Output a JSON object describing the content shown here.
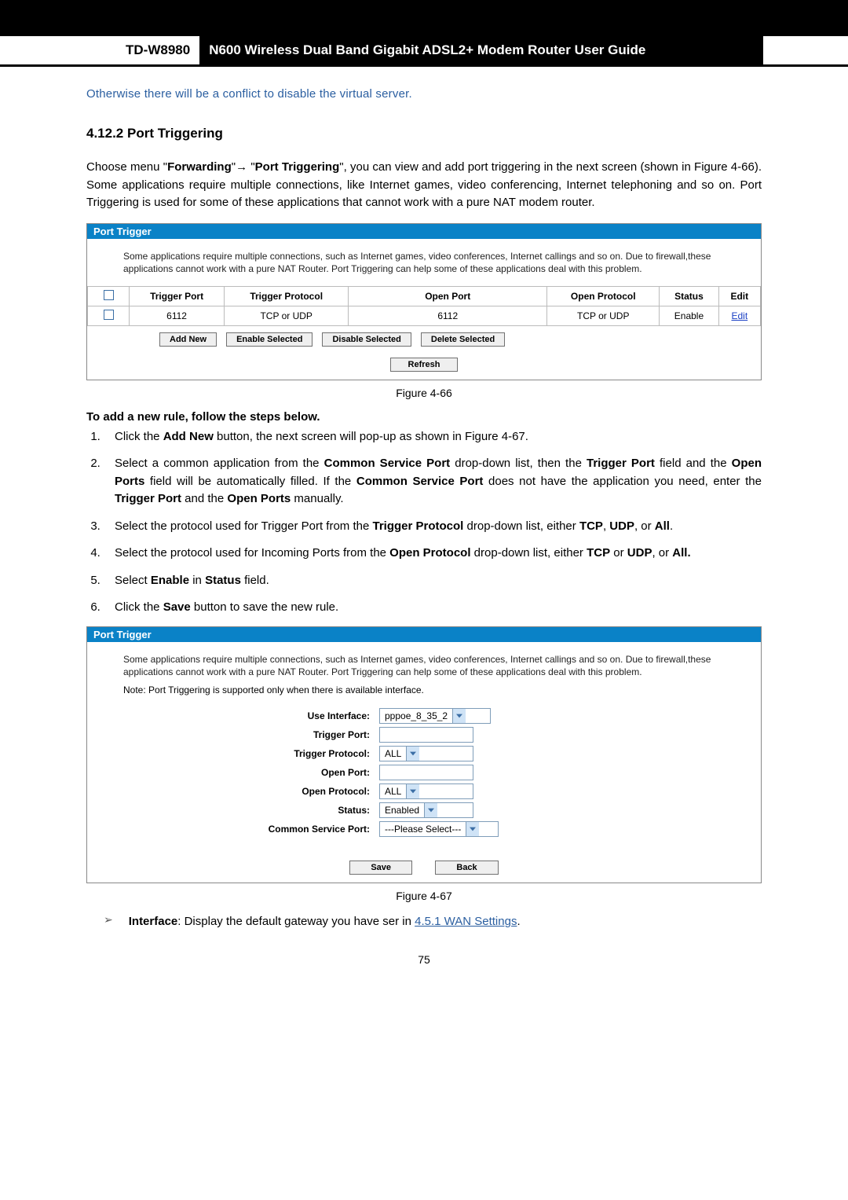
{
  "header": {
    "model": "TD-W8980",
    "guide_title": "N600 Wireless Dual Band Gigabit ADSL2+ Modem Router User Guide"
  },
  "note": "Otherwise there will be a conflict to disable the virtual server.",
  "section": {
    "number": "4.12.2",
    "title": "Port Triggering"
  },
  "intro": {
    "pre": "Choose menu \"",
    "menu1": "Forwarding",
    "arrow": "→",
    "quote_open": "\"",
    "menu2": "Port Triggering",
    "post": "\", you can view and add port triggering in the next screen (shown in Figure 4-66). Some applications require multiple connections, like Internet games, video conferencing, Internet telephoning and so on. Port Triggering is used for some of these applications that cannot work with a pure NAT modem router."
  },
  "panel1": {
    "title": "Port Trigger",
    "desc": "Some applications require multiple connections, such as Internet games, video conferences, Internet callings and so on. Due to firewall,these applications cannot work with a pure NAT Router. Port Triggering can help some of these applications deal with this problem.",
    "cols": {
      "trigger_port": "Trigger Port",
      "trigger_protocol": "Trigger Protocol",
      "open_port": "Open Port",
      "open_protocol": "Open Protocol",
      "status": "Status",
      "edit": "Edit"
    },
    "row": {
      "trigger_port": "6112",
      "trigger_protocol": "TCP or UDP",
      "open_port": "6112",
      "open_protocol": "TCP or UDP",
      "status": "Enable",
      "edit": "Edit"
    },
    "buttons": {
      "add_new": "Add New",
      "enable_sel": "Enable Selected",
      "disable_sel": "Disable Selected",
      "delete_sel": "Delete Selected",
      "refresh": "Refresh"
    }
  },
  "fig1": "Figure 4-66",
  "add_rule_heading": "To add a new rule, follow the steps below.",
  "steps": {
    "s1a": "Click the ",
    "s1b": "Add New",
    "s1c": " button, the next screen will pop-up as shown in Figure 4-67.",
    "s2a": "Select a common application from the ",
    "s2b": "Common Service Port",
    "s2c": " drop-down list, then the ",
    "s2d": "Trigger Port",
    "s2e": " field and the ",
    "s2f": "Open Ports",
    "s2g": " field will be automatically filled. If the ",
    "s2h": "Common Service Port",
    "s2i": " does not have the application you need, enter the ",
    "s2j": "Trigger Port",
    "s2k": " and the ",
    "s2l": "Open Ports",
    "s2m": " manually.",
    "s3a": "Select the protocol used for Trigger Port from the ",
    "s3b": "Trigger Protocol",
    "s3c": " drop-down list, either ",
    "s3d": "TCP",
    "s3e": ", ",
    "s3f": "UDP",
    "s3g": ", or ",
    "s3h": "All",
    "s3i": ".",
    "s4a": "Select the protocol used for Incoming Ports from the ",
    "s4b": "Open Protocol",
    "s4c": " drop-down list, either ",
    "s4d": "TCP",
    "s4e": " or ",
    "s4f": "UDP",
    "s4g": ", or ",
    "s4h": "All.",
    "s5a": "Select ",
    "s5b": "Enable",
    "s5c": " in ",
    "s5d": "Status",
    "s5e": " field.",
    "s6a": "Click the ",
    "s6b": "Save",
    "s6c": " button to save the new rule."
  },
  "panel2": {
    "title": "Port Trigger",
    "desc": "Some applications require multiple connections, such as Internet games, video conferences, Internet callings and so on. Due to firewall,these applications cannot work with a pure NAT Router. Port Triggering can help some of these applications deal with this problem.",
    "note": "Note: Port Triggering is supported only when there is available interface.",
    "labels": {
      "use_interface": "Use Interface:",
      "trigger_port": "Trigger Port:",
      "trigger_protocol": "Trigger Protocol:",
      "open_port": "Open Port:",
      "open_protocol": "Open Protocol:",
      "status": "Status:",
      "common_service_port": "Common Service Port:"
    },
    "values": {
      "use_interface": "pppoe_8_35_2",
      "trigger_protocol": "ALL",
      "open_protocol": "ALL",
      "status": "Enabled",
      "common_service_port": "---Please Select---"
    },
    "buttons": {
      "save": "Save",
      "back": "Back"
    }
  },
  "fig2": "Figure 4-67",
  "bullet": {
    "label": "Interface",
    "text": ": Display the default gateway you have ser in ",
    "link": "4.5.1 WAN Settings",
    "tail": "."
  },
  "page_number": "75"
}
